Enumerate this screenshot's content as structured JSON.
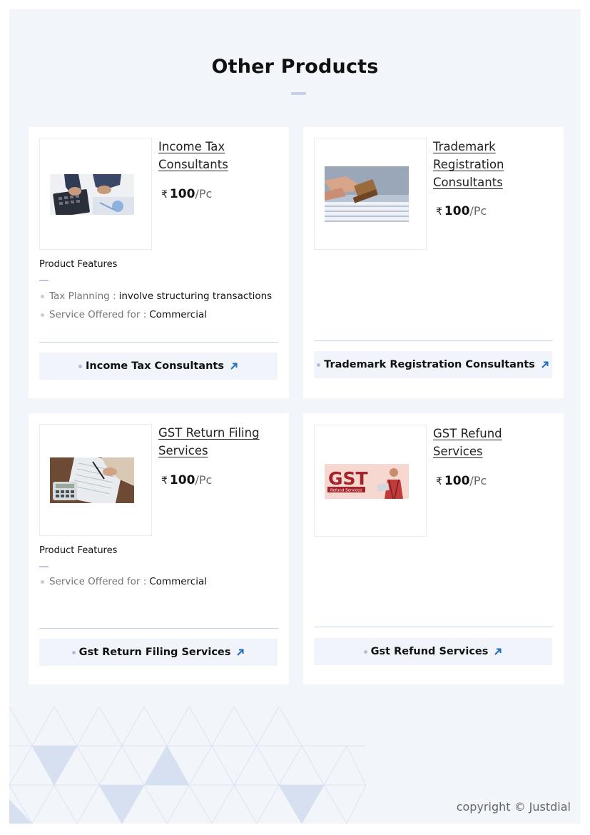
{
  "section": {
    "title": "Other Products"
  },
  "products": [
    {
      "name": "Income Tax Consultants",
      "currency_symbol": "₹",
      "price": "100",
      "unit": "/Pc",
      "features_label": "Product Features",
      "features": [
        {
          "key": "Tax Planning :",
          "value": "involve structuring transactions"
        },
        {
          "key": "Service Offered for :",
          "value": "Commercial"
        }
      ],
      "cta_label": "Income Tax Consultants"
    },
    {
      "name": "Trademark Registration Consultants",
      "currency_symbol": "₹",
      "price": "100",
      "unit": "/Pc",
      "cta_label": "Trademark Registration Consultants"
    },
    {
      "name": "GST Return Filing Services",
      "currency_symbol": "₹",
      "price": "100",
      "unit": "/Pc",
      "features_label": "Product Features",
      "features": [
        {
          "key": "Service Offered for :",
          "value": "Commercial"
        }
      ],
      "cta_label": "Gst Return Filing Services"
    },
    {
      "name": "GST Refund Services",
      "currency_symbol": "₹",
      "price": "100",
      "unit": "/Pc",
      "image_text": {
        "big": "GST",
        "small": "Refund Services"
      },
      "cta_label": "Gst Refund Services"
    }
  ],
  "footer": {
    "copyright": "copyright © Justdial"
  },
  "colors": {
    "page_background": "#f2f5fa",
    "card_background": "#ffffff",
    "arrow_accent": "#1a6fc0",
    "divider": "#c6d3ea"
  }
}
